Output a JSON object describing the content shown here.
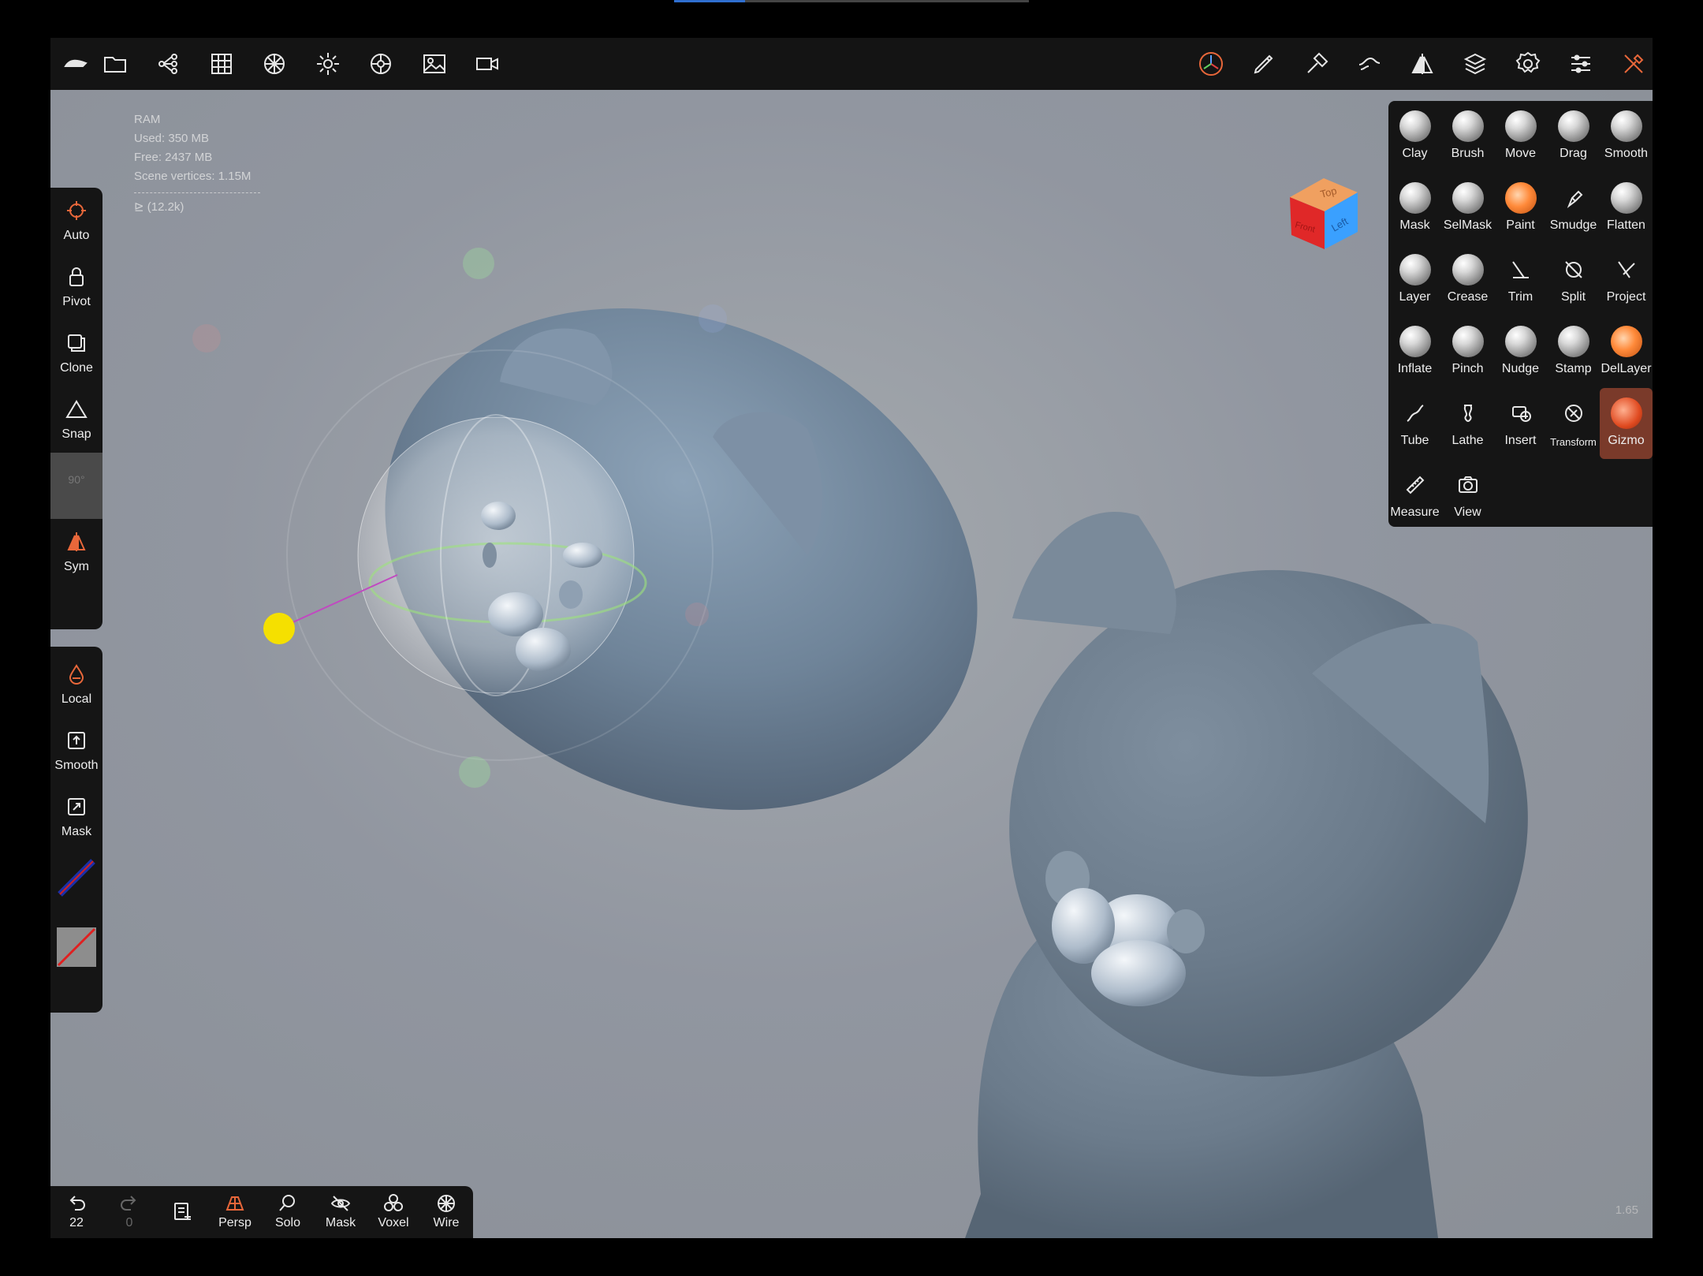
{
  "top_toolbar": {
    "left_icons": [
      "app-logo-icon",
      "folder-icon",
      "scene-tree-icon",
      "grid-icon",
      "material-icon",
      "light-icon",
      "environment-icon",
      "image-icon",
      "camera-icon"
    ],
    "right_icons": [
      "gizmo-icon",
      "pen-icon",
      "hammer-icon",
      "brush-stroke-icon",
      "symmetry-icon",
      "layers-icon",
      "settings-icon",
      "sliders-icon",
      "tools-icon"
    ],
    "accent": "#e8673a"
  },
  "stats": {
    "ram": "RAM",
    "used": "Used: 350 MB",
    "free": "Free: 2437 MB",
    "vertices": "Scene vertices: 1.15M",
    "mesh": "⊵ (12.2k)"
  },
  "left_tools_top": [
    {
      "label": "Auto",
      "icon": "crosshair-icon"
    },
    {
      "label": "Pivot",
      "icon": "lock-icon"
    },
    {
      "label": "Clone",
      "icon": "clone-icon"
    },
    {
      "label": "Snap",
      "icon": "triangle-icon"
    },
    {
      "label": "90°",
      "icon": "",
      "disabled": true
    },
    {
      "label": "Sym",
      "icon": "symmetry-icon"
    }
  ],
  "left_tools_bottom": [
    {
      "label": "Local",
      "icon": "drop-icon"
    },
    {
      "label": "Smooth",
      "icon": "smooth-box-icon"
    },
    {
      "label": "Mask",
      "icon": "mask-box-icon"
    }
  ],
  "brushes": [
    {
      "label": "Clay",
      "kind": "sphere"
    },
    {
      "label": "Brush",
      "kind": "sphere"
    },
    {
      "label": "Move",
      "kind": "sphere"
    },
    {
      "label": "Drag",
      "kind": "sphere"
    },
    {
      "label": "Smooth",
      "kind": "sphere"
    },
    {
      "label": "Mask",
      "kind": "sphere"
    },
    {
      "label": "SelMask",
      "kind": "sphere"
    },
    {
      "label": "Paint",
      "kind": "orange"
    },
    {
      "label": "Smudge",
      "kind": "icon"
    },
    {
      "label": "Flatten",
      "kind": "sphere"
    },
    {
      "label": "Layer",
      "kind": "sphere"
    },
    {
      "label": "Crease",
      "kind": "sphere"
    },
    {
      "label": "Trim",
      "kind": "icon"
    },
    {
      "label": "Split",
      "kind": "icon"
    },
    {
      "label": "Project",
      "kind": "icon"
    },
    {
      "label": "Inflate",
      "kind": "sphere"
    },
    {
      "label": "Pinch",
      "kind": "sphere"
    },
    {
      "label": "Nudge",
      "kind": "sphere"
    },
    {
      "label": "Stamp",
      "kind": "sphere"
    },
    {
      "label": "DelLayer",
      "kind": "orange"
    },
    {
      "label": "Tube",
      "kind": "icon"
    },
    {
      "label": "Lathe",
      "kind": "icon"
    },
    {
      "label": "Insert",
      "kind": "icon"
    },
    {
      "label": "Transform",
      "kind": "icon"
    },
    {
      "label": "Gizmo",
      "kind": "gizmo",
      "active": true
    },
    {
      "label": "Measure",
      "kind": "icon"
    },
    {
      "label": "View",
      "kind": "icon"
    }
  ],
  "bottom_bar": {
    "undo_count": "22",
    "redo_count": "0",
    "persp": "Persp",
    "solo": "Solo",
    "mask": "Mask",
    "voxel": "Voxel",
    "wire": "Wire"
  },
  "view_cube": {
    "top": "Top",
    "left": "Left",
    "front": "Front"
  },
  "zoom_readout": "1.65"
}
